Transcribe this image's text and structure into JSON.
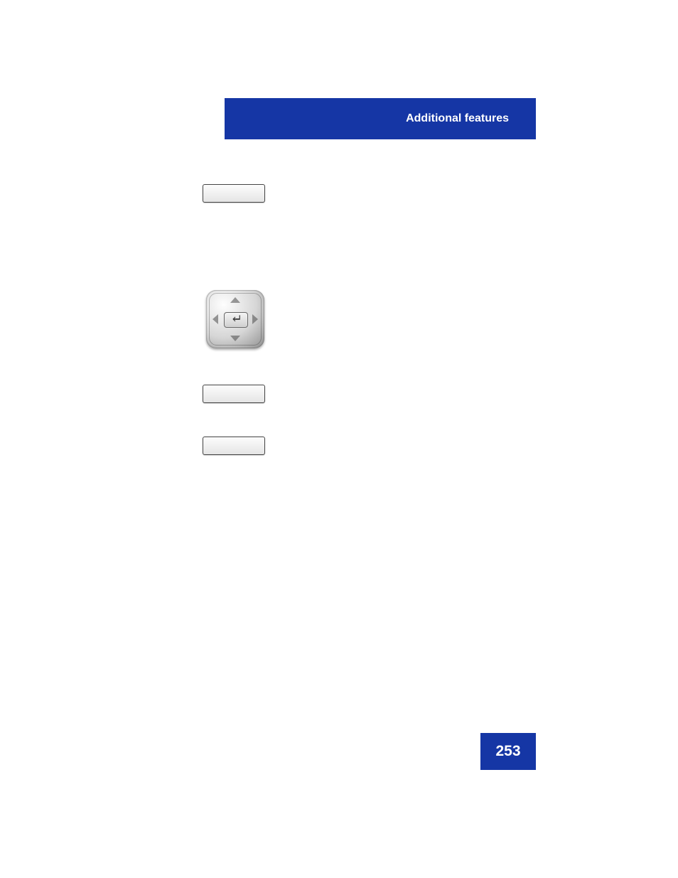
{
  "header": {
    "title": "Additional features"
  },
  "page_number": "253"
}
